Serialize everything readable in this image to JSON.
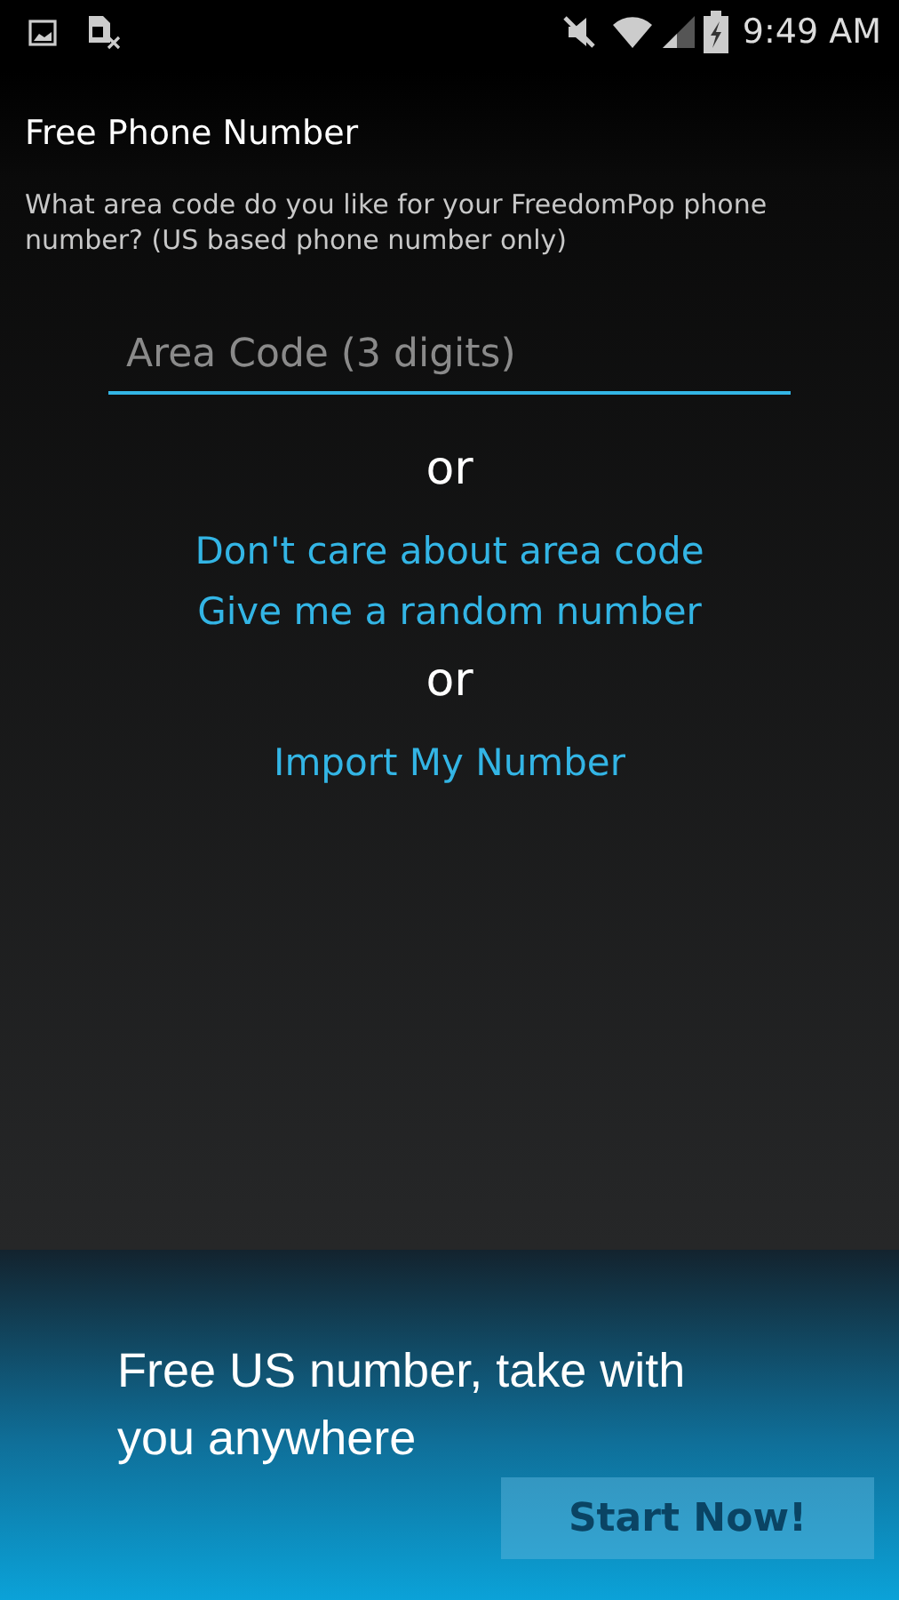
{
  "status_bar": {
    "time": "9:49 AM"
  },
  "title": "Free Phone Number",
  "prompt": "What area code do you like for your FreedomPop phone number? (US based phone number only)",
  "area_code": {
    "placeholder": "Area Code (3 digits)"
  },
  "options": [
    {
      "kind": "separator",
      "text": "or"
    },
    {
      "kind": "link",
      "text": "Don't care about area code\nGive me a random number"
    },
    {
      "kind": "separator",
      "text": "or"
    },
    {
      "kind": "link",
      "text": "Import My Number"
    }
  ],
  "banner": {
    "text": "Free US number, take with you anywhere",
    "button": "Start Now!"
  }
}
